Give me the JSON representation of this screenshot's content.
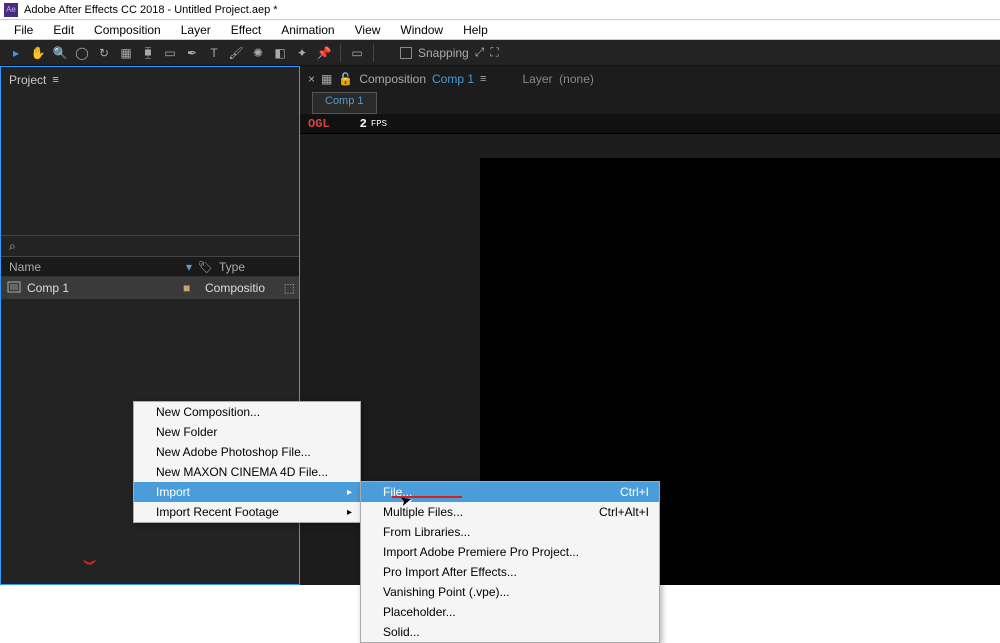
{
  "titleBar": {
    "appIconText": "Ae",
    "title": "Adobe After Effects CC 2018 - Untitled Project.aep *"
  },
  "menuBar": [
    "File",
    "Edit",
    "Composition",
    "Layer",
    "Effect",
    "Animation",
    "View",
    "Window",
    "Help"
  ],
  "toolbar": {
    "snappingLabel": "Snapping"
  },
  "projectPanel": {
    "tabLabel": "Project",
    "searchIcon": "⌕",
    "columns": {
      "name": "Name",
      "type": "Type"
    },
    "items": [
      {
        "name": "Comp 1",
        "type": "Compositio"
      }
    ]
  },
  "compositionPanel": {
    "closeX": "×",
    "lock": "🔒",
    "compLabel": "Composition",
    "compName": "Comp 1",
    "layerLabel": "Layer",
    "layerValue": "(none)",
    "subTab": "Comp 1",
    "ogl": "OGL",
    "fpsValue": "2",
    "fpsLabel": "FPS"
  },
  "contextMenu": {
    "main": [
      {
        "label": "New Composition...",
        "hl": false,
        "sub": false
      },
      {
        "label": "New Folder",
        "hl": false,
        "sub": false
      },
      {
        "label": "New Adobe Photoshop File...",
        "hl": false,
        "sub": false
      },
      {
        "label": "New MAXON CINEMA 4D File...",
        "hl": false,
        "sub": false
      },
      {
        "label": "Import",
        "hl": true,
        "sub": true
      },
      {
        "label": "Import Recent Footage",
        "hl": false,
        "sub": true
      }
    ],
    "sub": [
      {
        "label": "File...",
        "shortcut": "Ctrl+I",
        "hl": true
      },
      {
        "label": "Multiple Files...",
        "shortcut": "Ctrl+Alt+I",
        "hl": false
      },
      {
        "label": "From Libraries...",
        "shortcut": "",
        "hl": false
      },
      {
        "label": "Import Adobe Premiere Pro Project...",
        "shortcut": "",
        "hl": false
      },
      {
        "label": "Pro Import After Effects...",
        "shortcut": "",
        "hl": false
      },
      {
        "label": "Vanishing Point (.vpe)...",
        "shortcut": "",
        "hl": false
      },
      {
        "label": "Placeholder...",
        "shortcut": "",
        "hl": false
      },
      {
        "label": "Solid...",
        "shortcut": "",
        "hl": false
      }
    ]
  }
}
